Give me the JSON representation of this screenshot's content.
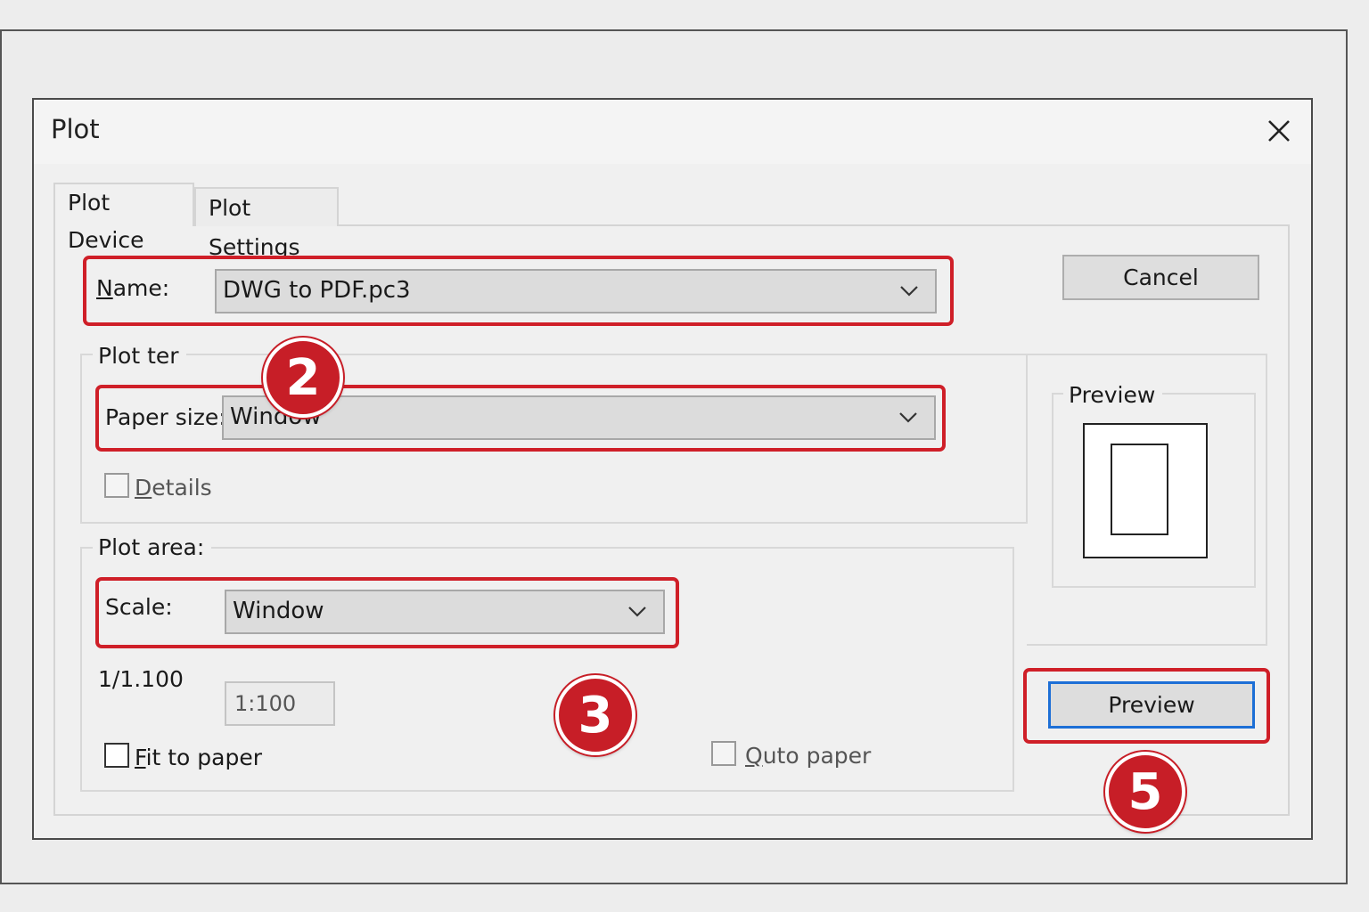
{
  "dialog": {
    "title": "Plot",
    "close_icon": "close-icon"
  },
  "tabs": [
    {
      "label": "Plot Device",
      "active": true
    },
    {
      "label": "Plot Settings",
      "active": false
    }
  ],
  "device": {
    "name_label": "Name:",
    "name_value": "DWG to PDF.pc3"
  },
  "plotter_group": {
    "title": "Plot ter",
    "paper_size_label": "Paper size:",
    "paper_size_value": "Window",
    "details_label": "Details"
  },
  "plot_area": {
    "title": "Plot area:",
    "scale_label": "Scale:",
    "scale_value": "Window",
    "ratio_label": "1/1.100",
    "ratio_value": "1:100",
    "fit_to_paper_label": "Fit to paper",
    "auto_paper_label": "Quto paper"
  },
  "buttons": {
    "cancel": "Cancel",
    "preview": "Preview"
  },
  "preview_group": {
    "title": "Preview"
  },
  "annotations": {
    "step_a": "2",
    "step_b": "3",
    "step_c": "5",
    "highlight_color": "#cf1f28"
  }
}
